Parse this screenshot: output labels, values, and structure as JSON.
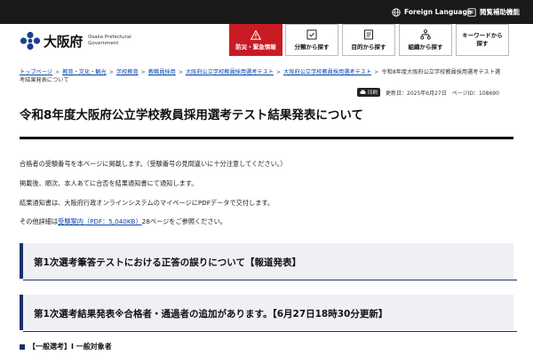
{
  "topbar": {
    "foreign_language": "Foreign Language",
    "reading_support": "閲覧補助機能",
    "bg_color": "#1a1a1a"
  },
  "header": {
    "logo_name": "大阪府",
    "logo_sub_line1": "Osaka Prefectural",
    "logo_sub_line2": "Government",
    "logo_icon": "osaka-prefecture-emblem-icon",
    "nav": {
      "disaster": "防災・緊急情報",
      "by_category": "分類から探す",
      "by_purpose": "目的から探す",
      "by_organization": "組織から探す",
      "keyword_line1": "キーワードから",
      "keyword_line2": "探す"
    },
    "accent_red": "#c91b24"
  },
  "breadcrumb": {
    "items": [
      "トップページ",
      "教育・文化・観光",
      "学校教育",
      "教職員採用",
      "大阪府公立学校教員採用選考テスト",
      "大阪府公立学校教員採用選考テスト"
    ],
    "current_line1": "令和8年度大阪府公立学校教員採用選考テスト選",
    "current_line2": "考結果発表について",
    "separator": ">"
  },
  "meta": {
    "print_label": "印刷",
    "updated": "更新日：2025年6月27日",
    "page_id": "ページID：108690"
  },
  "page": {
    "title": "令和8年度大阪府公立学校教員採用選考テスト結果発表について",
    "paragraphs": {
      "p1": "合格者の受験番号を本ページに掲載します。（受験番号の見間違いに十分注意してください。）",
      "p2": "掲載後、順次、本人あてに合否を結果通知書にて通知します。",
      "p3": "結果通知書は、大阪府行政オンラインシステムのマイページにPDFデータで交付します。",
      "p4_before": "その他詳細は",
      "p4_link": "受験案内（PDF：5,040KB）",
      "p4_after": "28ページをご参照ください。"
    },
    "notices": {
      "n1": "第1次選考筆答テストにおける正答の誤りについて【報道発表】",
      "n2": "第1次選考結果発表※合格者・通過者の追加があります。【6月27日18時30分更新】"
    },
    "subhead": "【一般選考】Ⅰ 一般対象者",
    "accent_navy": "#1b2f6a"
  }
}
